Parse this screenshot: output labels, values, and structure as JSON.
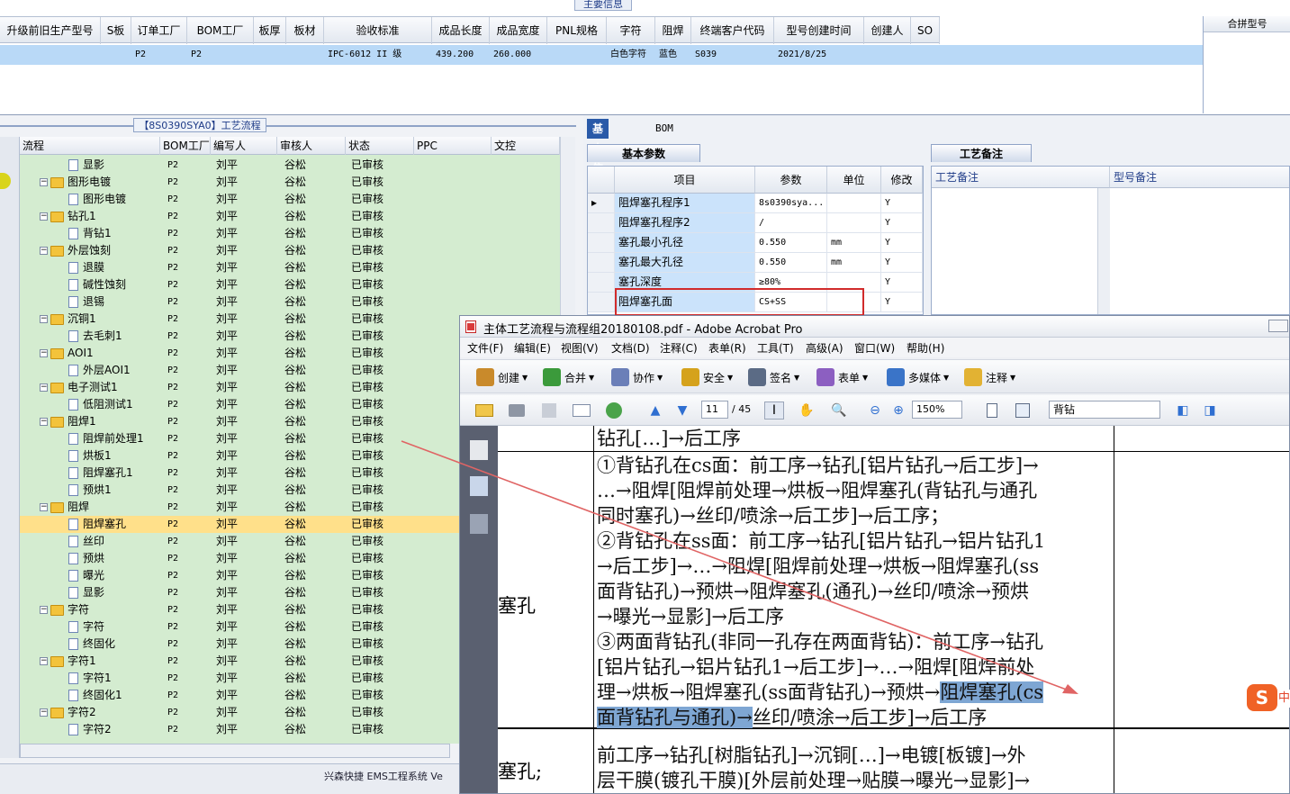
{
  "top": {
    "title": "主要信息",
    "columns": [
      "升级前旧生产型号",
      "S板",
      "订单工厂",
      "BOM工厂",
      "板厚",
      "板材",
      "验收标准",
      "成品长度",
      "成品宽度",
      "PNL规格",
      "字符",
      "阻焊",
      "终端客户代码",
      "型号创建时间",
      "创建人",
      "SO"
    ],
    "row": [
      "",
      "",
      "P2",
      "P2",
      "",
      "",
      "IPC-6012 II 级",
      "439.200",
      "260.000",
      "",
      "白色字符",
      "蓝色",
      "S039",
      "2021/8/25",
      "",
      ""
    ],
    "merge_title": "合拼型号"
  },
  "left": {
    "title": "【8S0390SYA0】工艺流程",
    "columns": [
      "流程",
      "BOM工厂",
      "编写人",
      "审核人",
      "状态",
      "PPC",
      "文控"
    ],
    "rows": [
      {
        "name": "显影",
        "lv": 2,
        "bom": "P2",
        "w": "刘平",
        "r": "谷松",
        "s": "已审核"
      },
      {
        "name": "图形电镀",
        "lv": 1,
        "bom": "P2",
        "w": "刘平",
        "r": "谷松",
        "s": "已审核"
      },
      {
        "name": "图形电镀",
        "lv": 2,
        "bom": "P2",
        "w": "刘平",
        "r": "谷松",
        "s": "已审核"
      },
      {
        "name": "钻孔1",
        "lv": 1,
        "bom": "P2",
        "w": "刘平",
        "r": "谷松",
        "s": "已审核"
      },
      {
        "name": "背钻1",
        "lv": 2,
        "bom": "P2",
        "w": "刘平",
        "r": "谷松",
        "s": "已审核"
      },
      {
        "name": "外层蚀刻",
        "lv": 1,
        "bom": "P2",
        "w": "刘平",
        "r": "谷松",
        "s": "已审核"
      },
      {
        "name": "退膜",
        "lv": 2,
        "bom": "P2",
        "w": "刘平",
        "r": "谷松",
        "s": "已审核"
      },
      {
        "name": "碱性蚀刻",
        "lv": 2,
        "bom": "P2",
        "w": "刘平",
        "r": "谷松",
        "s": "已审核"
      },
      {
        "name": "退锡",
        "lv": 2,
        "bom": "P2",
        "w": "刘平",
        "r": "谷松",
        "s": "已审核"
      },
      {
        "name": "沉铜1",
        "lv": 1,
        "bom": "P2",
        "w": "刘平",
        "r": "谷松",
        "s": "已审核"
      },
      {
        "name": "去毛刺1",
        "lv": 2,
        "bom": "P2",
        "w": "刘平",
        "r": "谷松",
        "s": "已审核"
      },
      {
        "name": "AOI1",
        "lv": 1,
        "bom": "P2",
        "w": "刘平",
        "r": "谷松",
        "s": "已审核"
      },
      {
        "name": "外层AOI1",
        "lv": 2,
        "bom": "P2",
        "w": "刘平",
        "r": "谷松",
        "s": "已审核"
      },
      {
        "name": "电子测试1",
        "lv": 1,
        "bom": "P2",
        "w": "刘平",
        "r": "谷松",
        "s": "已审核"
      },
      {
        "name": "低阻测试1",
        "lv": 2,
        "bom": "P2",
        "w": "刘平",
        "r": "谷松",
        "s": "已审核"
      },
      {
        "name": "阻焊1",
        "lv": 1,
        "bom": "P2",
        "w": "刘平",
        "r": "谷松",
        "s": "已审核"
      },
      {
        "name": "阻焊前处理1",
        "lv": 2,
        "bom": "P2",
        "w": "刘平",
        "r": "谷松",
        "s": "已审核"
      },
      {
        "name": "烘板1",
        "lv": 2,
        "bom": "P2",
        "w": "刘平",
        "r": "谷松",
        "s": "已审核"
      },
      {
        "name": "阻焊塞孔1",
        "lv": 2,
        "bom": "P2",
        "w": "刘平",
        "r": "谷松",
        "s": "已审核"
      },
      {
        "name": "预烘1",
        "lv": 2,
        "bom": "P2",
        "w": "刘平",
        "r": "谷松",
        "s": "已审核"
      },
      {
        "name": "阻焊",
        "lv": 1,
        "bom": "P2",
        "w": "刘平",
        "r": "谷松",
        "s": "已审核"
      },
      {
        "name": "阻焊塞孔",
        "lv": 2,
        "bom": "P2",
        "w": "刘平",
        "r": "谷松",
        "s": "已审核",
        "selected": true
      },
      {
        "name": "丝印",
        "lv": 2,
        "bom": "P2",
        "w": "刘平",
        "r": "谷松",
        "s": "已审核"
      },
      {
        "name": "预烘",
        "lv": 2,
        "bom": "P2",
        "w": "刘平",
        "r": "谷松",
        "s": "已审核"
      },
      {
        "name": "曝光",
        "lv": 2,
        "bom": "P2",
        "w": "刘平",
        "r": "谷松",
        "s": "已审核"
      },
      {
        "name": "显影",
        "lv": 2,
        "bom": "P2",
        "w": "刘平",
        "r": "谷松",
        "s": "已审核"
      },
      {
        "name": "字符",
        "lv": 1,
        "bom": "P2",
        "w": "刘平",
        "r": "谷松",
        "s": "已审核"
      },
      {
        "name": "字符",
        "lv": 2,
        "bom": "P2",
        "w": "刘平",
        "r": "谷松",
        "s": "已审核"
      },
      {
        "name": "终固化",
        "lv": 2,
        "bom": "P2",
        "w": "刘平",
        "r": "谷松",
        "s": "已审核"
      },
      {
        "name": "字符1",
        "lv": 1,
        "bom": "P2",
        "w": "刘平",
        "r": "谷松",
        "s": "已审核"
      },
      {
        "name": "字符1",
        "lv": 2,
        "bom": "P2",
        "w": "刘平",
        "r": "谷松",
        "s": "已审核"
      },
      {
        "name": "终固化1",
        "lv": 2,
        "bom": "P2",
        "w": "刘平",
        "r": "谷松",
        "s": "已审核"
      },
      {
        "name": "字符2",
        "lv": 1,
        "bom": "P2",
        "w": "刘平",
        "r": "谷松",
        "s": "已审核"
      },
      {
        "name": "字符2",
        "lv": 2,
        "bom": "P2",
        "w": "刘平",
        "r": "谷松",
        "s": "已审核"
      }
    ],
    "status_text": "兴森快捷 EMS工程系统 Ve"
  },
  "right": {
    "tabs": [
      "基本信息",
      "BOM"
    ],
    "subtab": "基本参数",
    "param_columns": [
      "项目",
      "参数",
      "单位",
      "修改"
    ],
    "params": [
      [
        "阻焊塞孔程序1",
        "8s0390sya...",
        "",
        "Y"
      ],
      [
        "阻焊塞孔程序2",
        "/",
        "",
        "Y"
      ],
      [
        "塞孔最小孔径",
        "0.550",
        "mm",
        "Y"
      ],
      [
        "塞孔最大孔径",
        "0.550",
        "mm",
        "Y"
      ],
      [
        "塞孔深度",
        "≥80%",
        "",
        "Y"
      ],
      [
        "阻焊塞孔面",
        "CS+SS",
        "",
        "Y"
      ]
    ],
    "craft_tab": "工艺备注",
    "craft_columns": [
      "工艺备注",
      "型号备注"
    ]
  },
  "acrobat": {
    "title": "主体工艺流程与流程组20180108.pdf - Adobe Acrobat Pro",
    "menu": [
      "文件(F)",
      "编辑(E)",
      "视图(V)",
      "文档(D)",
      "注释(C)",
      "表单(R)",
      "工具(T)",
      "高级(A)",
      "窗口(W)",
      "帮助(H)"
    ],
    "toolbar": [
      "创建",
      "合并",
      "协作",
      "安全",
      "签名",
      "表单",
      "多媒体",
      "注释"
    ],
    "page_current": "11",
    "page_total": "/ 45",
    "zoom": "150%",
    "search": "背钻",
    "doc_lines": [
      "钻孔[…]→后工序",
      "①背钻孔在cs面：前工序→钻孔[铝片钻孔→后工步]→",
      "…→阻焊[阻焊前处理→烘板→阻焊塞孔(背钻孔与通孔",
      "同时塞孔)→丝印/喷涂→后工步]→后工序；",
      "②背钻孔在ss面：前工序→钻孔[铝片钻孔→铝片钻孔1",
      "→后工步]→…→阻焊[阻焊前处理→烘板→阻焊塞孔(ss",
      "面背钻孔)→预烘→阻焊塞孔(通孔)→丝印/喷涂→预烘",
      "→曝光→显影]→后工序",
      "③两面背钻孔(非同一孔存在两面背钻)：前工序→钻孔",
      "[铝片钻孔→铝片钻孔1→后工步]→…→阻焊[阻焊前处",
      "理→烘板→阻焊塞孔(ss面背钻孔)→预烘→",
      "阻焊塞孔(cs",
      "面背钻孔与通孔)→",
      "丝印/喷涂→后工步]→后工序",
      "前工序→钻孔[树脂钻孔]→沉铜[…]→电镀[板镀]→外",
      "层干膜(镀孔干膜)[外层前处理→贴膜→曝光→显影]→"
    ],
    "side_labels": [
      "塞孔",
      "塞孔;"
    ]
  },
  "ime": {
    "badge": "S",
    "tail": "中"
  }
}
